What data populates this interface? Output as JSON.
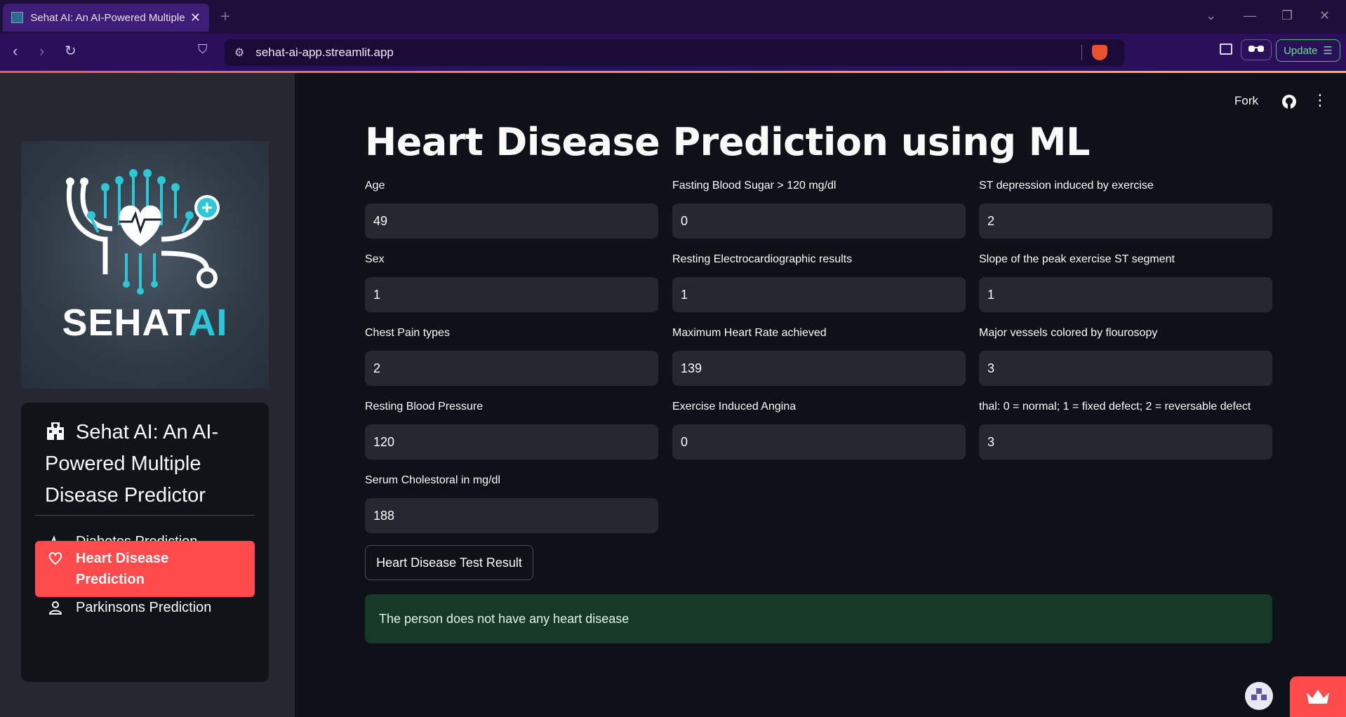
{
  "browser": {
    "tab_title": "Sehat AI: An AI-Powered Multiple Disease Predictor",
    "url": "sehat-ai-app.streamlit.app",
    "update_label": "Update"
  },
  "sidebar": {
    "logo_text_main": "SEHAT",
    "logo_text_accent": "AI",
    "menu_title": "Sehat AI: An AI-Powered Multiple Disease Predictor",
    "items": [
      {
        "label": "Diabetes Prediction",
        "icon": "activity-icon"
      },
      {
        "label": "Heart Disease Prediction",
        "icon": "heart-icon",
        "active": true
      },
      {
        "label": "Parkinsons Prediction",
        "icon": "person-icon"
      }
    ]
  },
  "header": {
    "fork_label": "Fork"
  },
  "main": {
    "title": "Heart Disease Prediction using ML",
    "fields": [
      {
        "label": "Age",
        "value": "49"
      },
      {
        "label": "Fasting Blood Sugar > 120 mg/dl",
        "value": "0"
      },
      {
        "label": "ST depression induced by exercise",
        "value": "2"
      },
      {
        "label": "Sex",
        "value": "1"
      },
      {
        "label": "Resting Electrocardiographic results",
        "value": "1"
      },
      {
        "label": "Slope of the peak exercise ST segment",
        "value": "1"
      },
      {
        "label": "Chest Pain types",
        "value": "2"
      },
      {
        "label": "Maximum Heart Rate achieved",
        "value": "139"
      },
      {
        "label": "Major vessels colored by flourosopy",
        "value": "3"
      },
      {
        "label": "Resting Blood Pressure",
        "value": "120"
      },
      {
        "label": "Exercise Induced Angina",
        "value": "0"
      },
      {
        "label": "thal: 0 = normal; 1 = fixed defect; 2 = reversable defect",
        "value": "3"
      },
      {
        "label": "Serum Cholestoral in mg/dl",
        "value": "188"
      }
    ],
    "button_label": "Heart Disease Test Result",
    "result_message": "The person does not have any heart disease"
  },
  "colors": {
    "accent": "#ff4b4b",
    "background": "#0e1117",
    "sidebar": "#262730",
    "success": "#173928"
  }
}
